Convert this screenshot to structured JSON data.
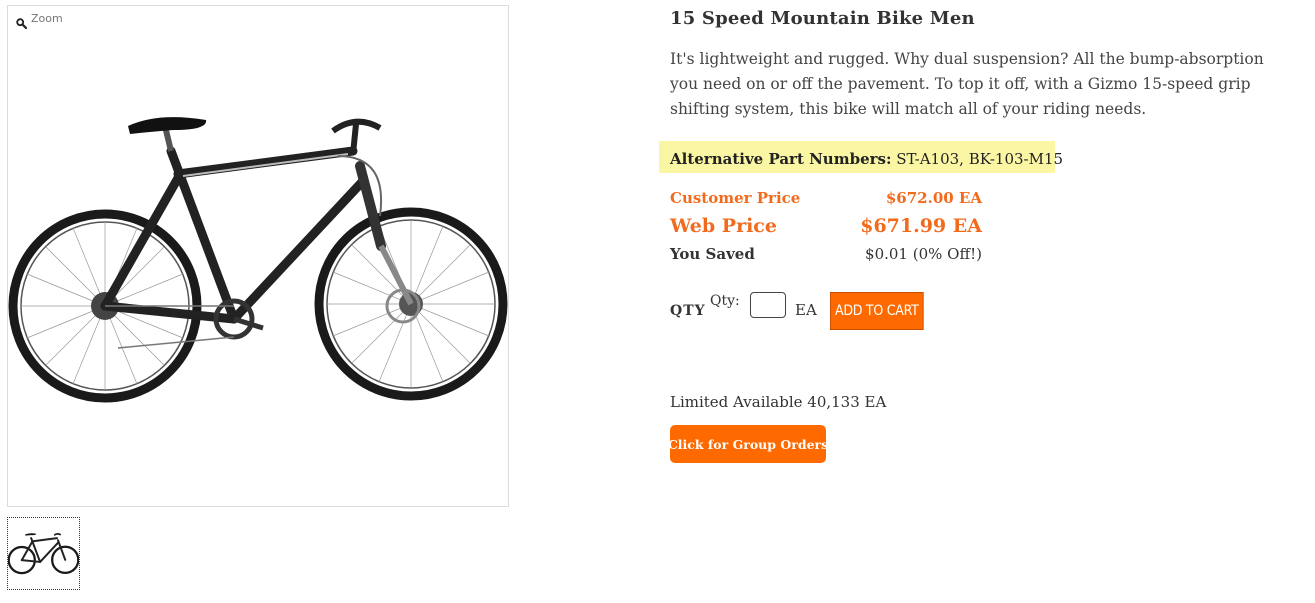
{
  "gallery": {
    "zoom_label": "Zoom",
    "zoom_icon": "magnifier-icon",
    "main_image": "mountain-bike-photo",
    "thumbnail": "mountain-bike-thumbnail"
  },
  "product": {
    "title": "15 Speed Mountain Bike Men",
    "description": "It's lightweight and rugged. Why dual suspension? All the bump-absorption you need on or off the pavement. To top it off, with a Gizmo 15-speed grip shifting system, this bike will match all of your riding needs.",
    "alt_parts_label": "Alternative Part Numbers:",
    "alt_parts_value": "ST-A103, BK-103-M15"
  },
  "pricing": {
    "customer_price_label": "Customer Price",
    "customer_price_value": "$672.00 EA",
    "web_price_label": "Web Price",
    "web_price_value": "$671.99 EA",
    "saved_label": "You Saved",
    "saved_value": "$0.01 (0% Off!)"
  },
  "cart": {
    "qty_label": "QTY",
    "qty_small_label": "Qty:",
    "qty_value": "",
    "unit": "EA",
    "add_to_cart": "ADD TO CART"
  },
  "availability": {
    "text": "Limited Available 40,133 EA",
    "group_orders_label": "Click for Group Orders"
  },
  "colors": {
    "accent": "#ff6a00",
    "price": "#f26b1d",
    "highlight": "#fbf6a4"
  }
}
